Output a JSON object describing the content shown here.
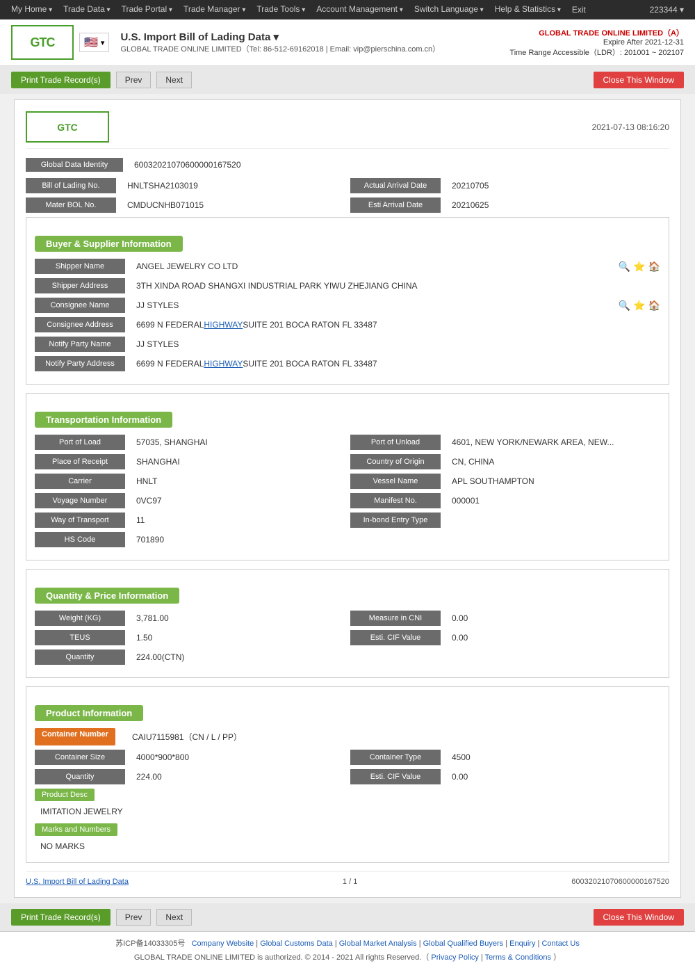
{
  "topnav": {
    "items": [
      "My Home",
      "Trade Data",
      "Trade Portal",
      "Trade Manager",
      "Trade Tools",
      "Account Management",
      "Switch Language",
      "Help & Statistics",
      "Exit"
    ],
    "user_id": "223344 ▾"
  },
  "header": {
    "logo_text": "GTC",
    "flag_emoji": "🇺🇸",
    "title": "U.S. Import Bill of Lading Data ▾",
    "subtitle": "GLOBAL TRADE ONLINE LIMITED（Tel: 86-512-69162018 | Email: vip@pierschina.com.cn）",
    "company": "GLOBAL TRADE ONLINE LIMITED（A）",
    "expire": "Expire After 2021-12-31",
    "time_range": "Time Range Accessible（LDR）: 201001 ~ 202107"
  },
  "toolbar": {
    "print_label": "Print Trade Record(s)",
    "prev_label": "Prev",
    "next_label": "Next",
    "close_label": "Close This Window"
  },
  "record": {
    "date": "2021-07-13 08:16:20",
    "logo_text": "GTC",
    "global_data_identity_label": "Global Data Identity",
    "global_data_identity": "60032021070600000167520",
    "bill_of_lading_label": "Bill of Lading No.",
    "bill_of_lading": "HNLTSHA2103019",
    "actual_arrival_label": "Actual Arrival Date",
    "actual_arrival": "20210705",
    "mater_bol_label": "Mater BOL No.",
    "mater_bol": "CMDUCNHB071015",
    "esti_arrival_label": "Esti Arrival Date",
    "esti_arrival": "20210625"
  },
  "buyer_supplier": {
    "section_title": "Buyer & Supplier Information",
    "shipper_name_label": "Shipper Name",
    "shipper_name": "ANGEL JEWELRY CO LTD",
    "shipper_address_label": "Shipper Address",
    "shipper_address": "3TH XINDA ROAD SHANGXI INDUSTRIAL PARK YIWU ZHEJIANG CHINA",
    "consignee_name_label": "Consignee Name",
    "consignee_name": "JJ STYLES",
    "consignee_address_label": "Consignee Address",
    "consignee_address": "6699 N FEDERAL HIGHWAY SUITE 201 BOCA RATON FL 33487",
    "notify_party_name_label": "Notify Party Name",
    "notify_party_name": "JJ STYLES",
    "notify_party_address_label": "Notify Party Address",
    "notify_party_address": "6699 N FEDERAL HIGHWAY SUITE 201 BOCA RATON FL 33487"
  },
  "transportation": {
    "section_title": "Transportation Information",
    "port_of_load_label": "Port of Load",
    "port_of_load": "57035, SHANGHAI",
    "port_of_unload_label": "Port of Unload",
    "port_of_unload": "4601, NEW YORK/NEWARK AREA, NEW...",
    "place_of_receipt_label": "Place of Receipt",
    "place_of_receipt": "SHANGHAI",
    "country_of_origin_label": "Country of Origin",
    "country_of_origin": "CN, CHINA",
    "carrier_label": "Carrier",
    "carrier": "HNLT",
    "vessel_name_label": "Vessel Name",
    "vessel_name": "APL SOUTHAMPTON",
    "voyage_number_label": "Voyage Number",
    "voyage_number": "0VC97",
    "manifest_no_label": "Manifest No.",
    "manifest_no": "000001",
    "way_of_transport_label": "Way of Transport",
    "way_of_transport": "11",
    "in_bond_entry_label": "In-bond Entry Type",
    "in_bond_entry": "",
    "hs_code_label": "HS Code",
    "hs_code": "701890"
  },
  "quantity_price": {
    "section_title": "Quantity & Price Information",
    "weight_label": "Weight (KG)",
    "weight": "3,781.00",
    "measure_in_cni_label": "Measure in CNI",
    "measure_in_cni": "0.00",
    "teus_label": "TEUS",
    "teus": "1.50",
    "esti_cif_value_label": "Esti. CIF Value",
    "esti_cif_value": "0.00",
    "quantity_label": "Quantity",
    "quantity": "224.00(CTN)"
  },
  "product": {
    "section_title": "Product Information",
    "container_number_label": "Container Number",
    "container_number": "CAIU7115981（CN / L / PP）",
    "container_size_label": "Container Size",
    "container_size": "4000*900*800",
    "container_type_label": "Container Type",
    "container_type": "4500",
    "quantity_label": "Quantity",
    "quantity": "224.00",
    "esti_cif_value_label": "Esti. CIF Value",
    "esti_cif_value": "0.00",
    "product_desc_label": "Product Desc",
    "product_desc": "IMITATION JEWELRY",
    "marks_label": "Marks and Numbers",
    "marks": "NO MARKS"
  },
  "record_footer": {
    "source": "U.S. Import Bill of Lading Data",
    "page": "1 / 1",
    "id": "60032021070600000167520"
  },
  "footer": {
    "links": [
      "Company Website",
      "Global Customs Data",
      "Global Market Analysis",
      "Global Qualified Buyers",
      "Enquiry",
      "Contact Us"
    ],
    "copyright": "GLOBAL TRADE ONLINE LIMITED is authorized. © 2014 - 2021 All rights Reserved.（",
    "privacy": "Privacy Policy",
    "sep": " | ",
    "terms": "Terms & Conditions",
    "copyright_end": "）",
    "icp": "苏ICP备14033305号"
  }
}
